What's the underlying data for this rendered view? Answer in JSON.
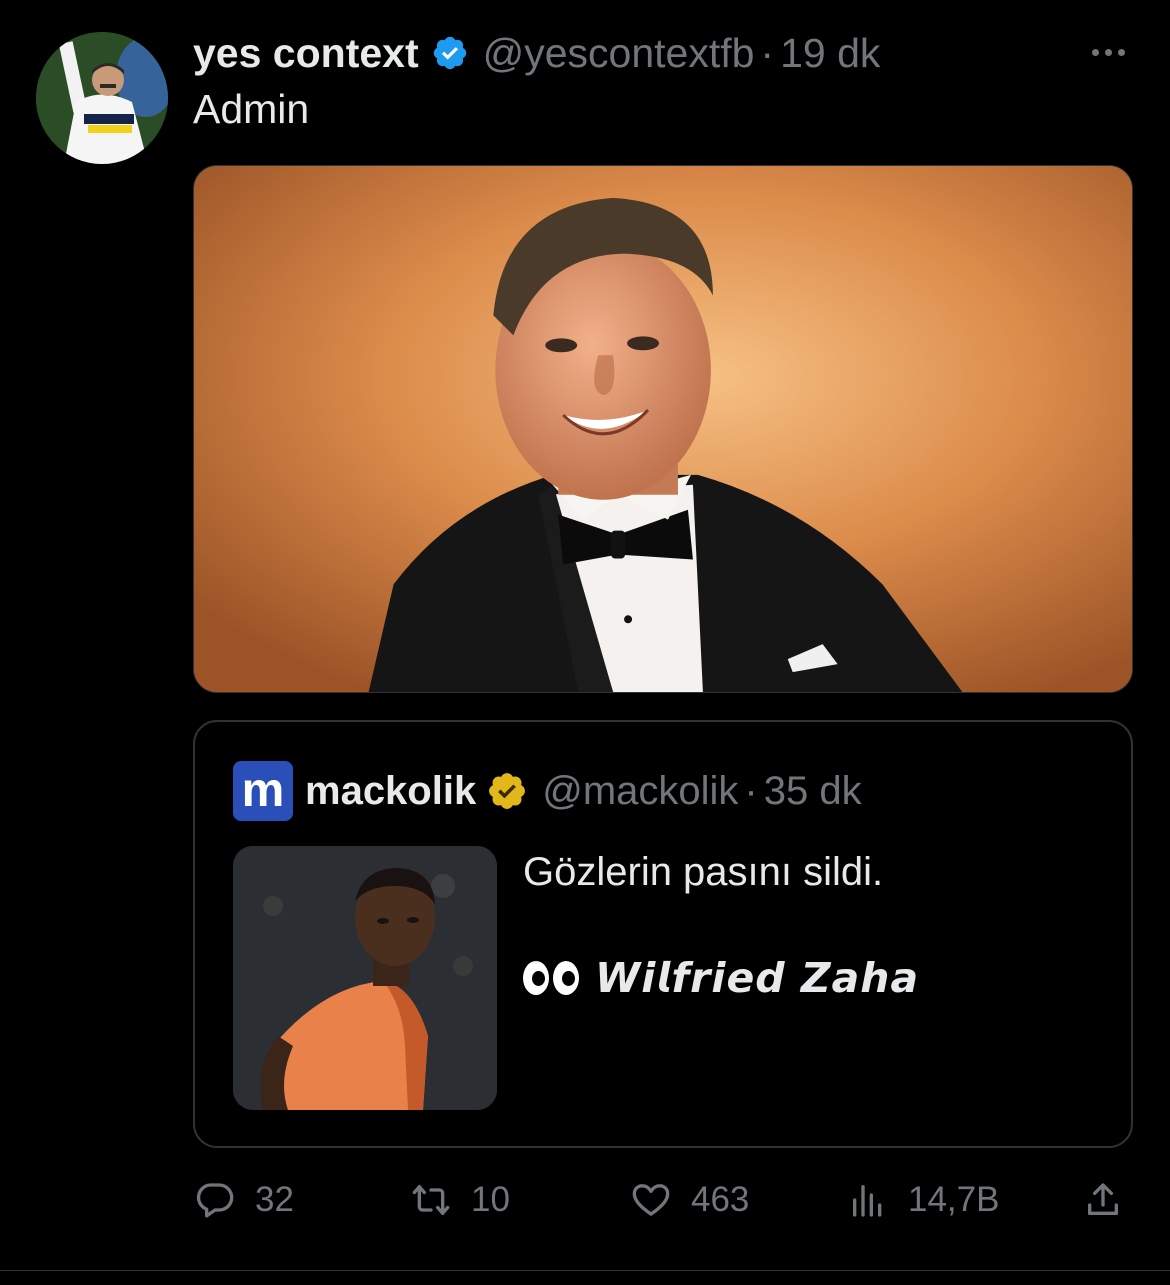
{
  "author": {
    "display_name": "yes context",
    "handle": "@yescontextfb",
    "separator": "·",
    "time": "19 dk",
    "verified": true,
    "verified_color": "#1d9bf0"
  },
  "tweet": {
    "text": "Admin"
  },
  "quote": {
    "logo_letter": "m",
    "logo_color": "#2a4fb8",
    "display_name": "mackolik",
    "handle": "@mackolik",
    "separator": "·",
    "time": "35 dk",
    "verified_color": "#e2b719",
    "text": "Gözlerin pasını sildi.",
    "emoji": "eyes",
    "player_name": "𝙒𝙞𝙡𝙛𝙧𝙞𝙚𝙙 𝙕𝙖𝙝𝙖"
  },
  "actions": {
    "replies": "32",
    "retweets": "10",
    "likes": "463",
    "views": "14,7B"
  },
  "colors": {
    "background": "#000000",
    "text": "#e7e9ea",
    "muted": "#71767b",
    "border": "#2f3336"
  },
  "icons": {
    "reply": "reply-icon",
    "retweet": "retweet-icon",
    "like": "heart-icon",
    "views": "views-chart-icon",
    "share": "share-icon",
    "more": "more-dots-icon"
  }
}
